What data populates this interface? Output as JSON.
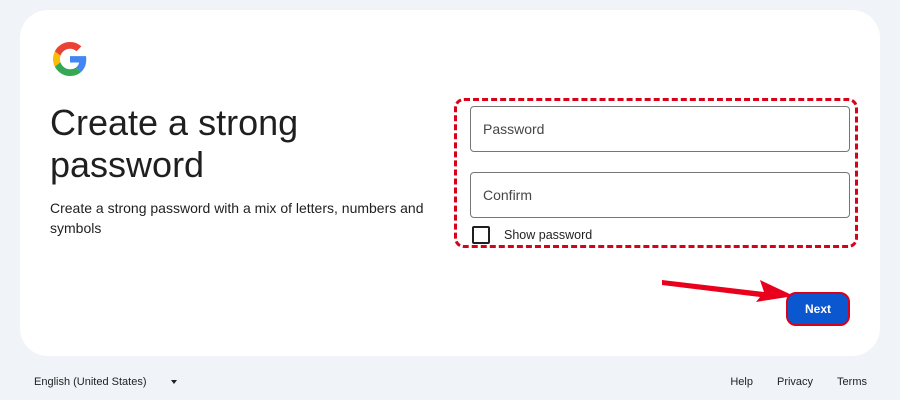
{
  "header": {
    "title": "Create a strong password",
    "subtitle": "Create a strong password with a mix of letters, numbers and symbols"
  },
  "logo": {
    "icon": "google-g-logo",
    "colors": [
      "#4285F4",
      "#EA4335",
      "#FBBC05",
      "#34A853"
    ]
  },
  "form": {
    "password_placeholder": "Password",
    "confirm_placeholder": "Confirm",
    "show_password_label": "Show password",
    "show_password_checked": false
  },
  "actions": {
    "next_label": "Next"
  },
  "footer": {
    "language": "English (United States)",
    "links": [
      "Help",
      "Privacy",
      "Terms"
    ]
  },
  "annotation": {
    "color": "#d9001b",
    "icon": "arrow-right-icon"
  },
  "colors": {
    "primary": "#0b57d0",
    "background": "#f0f4f9"
  }
}
